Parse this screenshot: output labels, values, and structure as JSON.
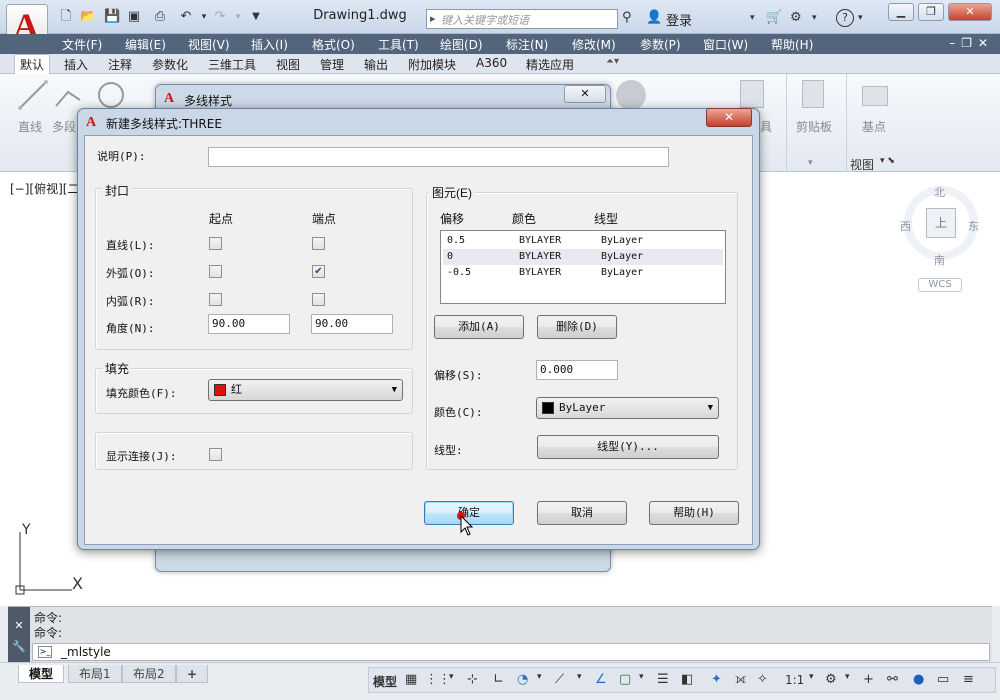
{
  "app": {
    "doc_title": "Drawing1.dwg",
    "search_placeholder": "键入关键字或短语",
    "login": "登录"
  },
  "menu": [
    "文件(F)",
    "编辑(E)",
    "视图(V)",
    "插入(I)",
    "格式(O)",
    "工具(T)",
    "绘图(D)",
    "标注(N)",
    "修改(M)",
    "参数(P)",
    "窗口(W)",
    "帮助(H)"
  ],
  "ribbon_tabs": [
    "默认",
    "插入",
    "注释",
    "参数化",
    "三维工具",
    "视图",
    "管理",
    "输出",
    "附加模块",
    "A360",
    "精选应用"
  ],
  "ribbon": {
    "line": "直线",
    "multiline": "多段",
    "clipboard": "剪贴板",
    "base": "基点",
    "view_panel": "视图",
    "utility_partial": "具"
  },
  "viewport": {
    "view_label": "[−][俯视][二",
    "north": "北",
    "south": "南",
    "east": "东",
    "west": "西",
    "top_face": "上",
    "wcs": "WCS",
    "axis_x": "X",
    "axis_y": "Y"
  },
  "command": {
    "history": [
      "命令:",
      "命令:"
    ],
    "input": "_mlstyle"
  },
  "layout_tabs": [
    "模型",
    "布局1",
    "布局2",
    "+"
  ],
  "status": {
    "model": "模型",
    "scale": "1:1"
  },
  "bg_dialog": {
    "title": "多线样式"
  },
  "dialog": {
    "title": "新建多线样式:THREE",
    "description_label": "说明(P):",
    "description_value": "",
    "caps": {
      "group_label": "封口",
      "start_header": "起点",
      "end_header": "端点",
      "rows": [
        {
          "label": "直线(L):",
          "start": false,
          "end": false
        },
        {
          "label": "外弧(O):",
          "start": false,
          "end": true
        },
        {
          "label": "内弧(R):",
          "start": false,
          "end": false
        }
      ],
      "angle_label": "角度(N):",
      "angle_start": "90.00",
      "angle_end": "90.00"
    },
    "fill": {
      "group_label": "填充",
      "color_label": "填充颜色(F):",
      "color_value": "红",
      "color_swatch": "#e01010"
    },
    "joints": {
      "label": "显示连接(J):",
      "checked": false
    },
    "elements": {
      "group_label": "图元(E)",
      "col_offset": "偏移",
      "col_color": "颜色",
      "col_linetype": "线型",
      "rows": [
        {
          "offset": "0.5",
          "color": "BYLAYER",
          "linetype": "ByLayer"
        },
        {
          "offset": "0",
          "color": "BYLAYER",
          "linetype": "ByLayer"
        },
        {
          "offset": "-0.5",
          "color": "BYLAYER",
          "linetype": "ByLayer"
        }
      ],
      "add_button": "添加(A)",
      "delete_button": "删除(D)",
      "offset_label": "偏移(S):",
      "offset_value": "0.000",
      "color_label": "颜色(C):",
      "color_value": "ByLayer",
      "color_swatch": "#000000",
      "linetype_label": "线型:",
      "linetype_button": "线型(Y)..."
    },
    "buttons": {
      "ok": "确定",
      "cancel": "取消",
      "help": "帮助(H)"
    }
  }
}
